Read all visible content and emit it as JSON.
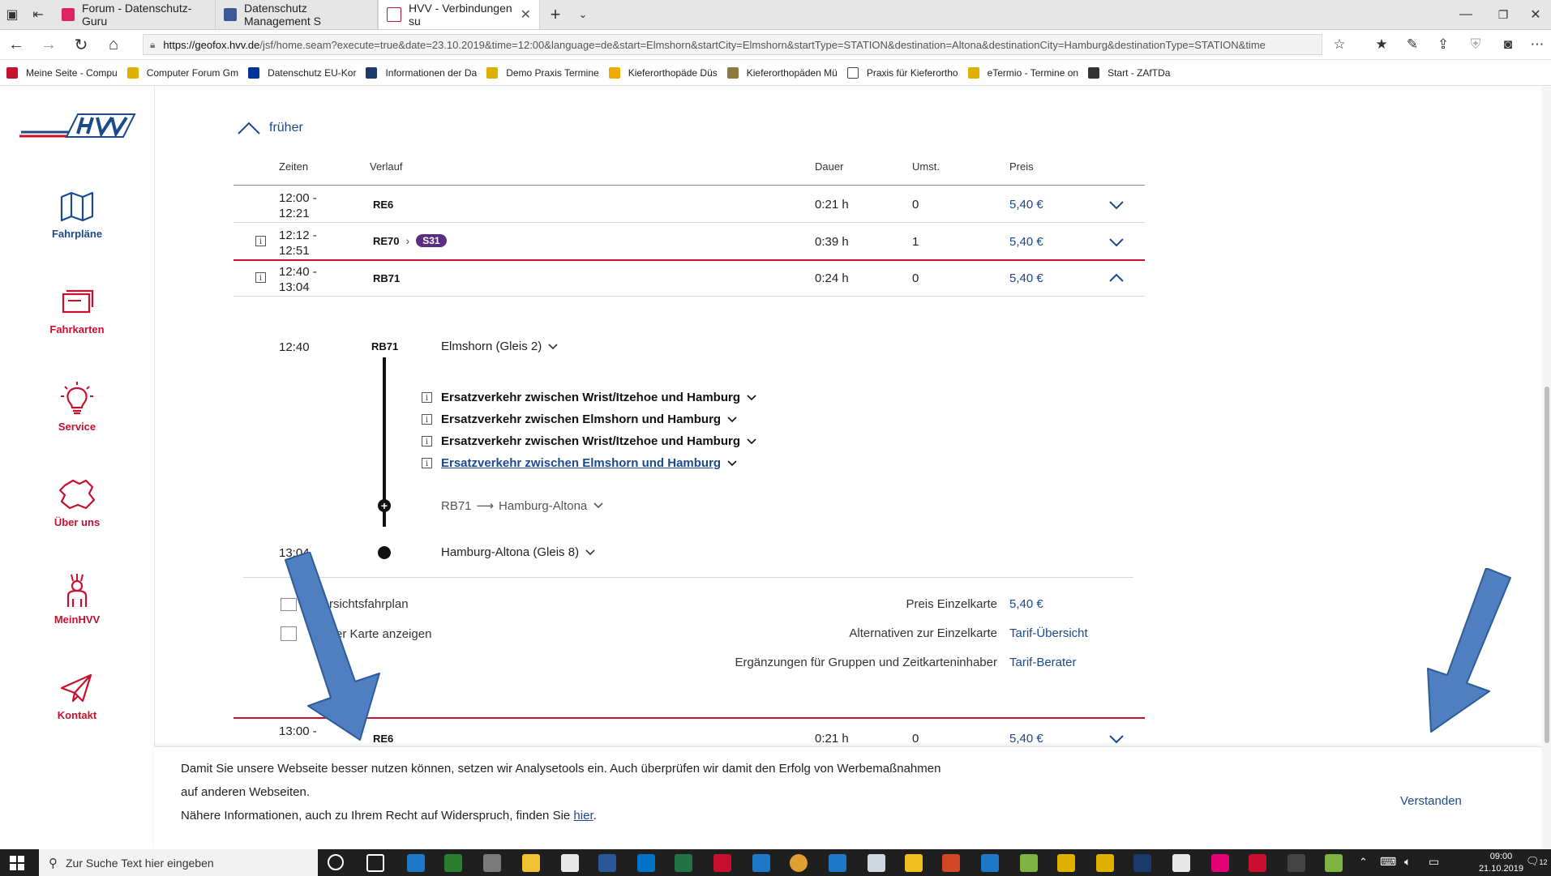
{
  "browser": {
    "tabs": [
      {
        "title": "Forum - Datenschutz-Guru",
        "color": "#e0245e"
      },
      {
        "title": "Datenschutz Management S",
        "color": "#3b5998"
      },
      {
        "title": "HVV - Verbindungen su",
        "color": "#c8102e"
      }
    ],
    "url_host": "https://geofox.hvv.de",
    "url_path": "/jsf/home.seam?execute=true&date=23.10.2019&time=12:00&language=de&start=Elmshorn&startCity=Elmshorn&startType=STATION&destination=Altona&destinationCity=Hamburg&destinationType=STATION&time",
    "favorites": [
      {
        "label": "Meine Seite - Compu",
        "color": "#c8102e"
      },
      {
        "label": "Computer Forum Gm",
        "color": "#e0b000"
      },
      {
        "label": "Datenschutz  EU-Kor",
        "color": "#003399"
      },
      {
        "label": "Informationen der Da",
        "color": "#1b3a6b"
      },
      {
        "label": "Demo Praxis Termine",
        "color": "#e0b000"
      },
      {
        "label": "Kieferorthopäde Düs",
        "color": "#f2a900"
      },
      {
        "label": "Kieferorthopäden Mü",
        "color": "#8a7a40"
      },
      {
        "label": "Praxis für Kieferortho",
        "color": "#444444"
      },
      {
        "label": "eTermio - Termine on",
        "color": "#e0b000"
      },
      {
        "label": "Start - ZAfTDa",
        "color": "#333333"
      }
    ]
  },
  "sidebar": {
    "items": [
      {
        "label": "Fahrpläne",
        "icon": "map-icon"
      },
      {
        "label": "Fahrkarten",
        "icon": "ticket-icon"
      },
      {
        "label": "Service",
        "icon": "lightbulb-icon"
      },
      {
        "label": "Über uns",
        "icon": "region-map-icon"
      },
      {
        "label": "MeinHVV",
        "icon": "person-icon"
      },
      {
        "label": "Kontakt",
        "icon": "paper-plane-icon"
      }
    ]
  },
  "results": {
    "earlier": "früher",
    "headers": {
      "zeiten": "Zeiten",
      "verlauf": "Verlauf",
      "dauer": "Dauer",
      "umst": "Umst.",
      "preis": "Preis"
    },
    "rows": [
      {
        "start": "12:00 -",
        "end": "12:21",
        "line": "RE6",
        "duration": "0:21 h",
        "changes": "0",
        "price": "5,40 €"
      },
      {
        "start": "12:12 -",
        "end": "12:51",
        "line": "RE70",
        "line2": "S31",
        "duration": "0:39 h",
        "changes": "1",
        "price": "5,40 €"
      },
      {
        "start": "12:40 -",
        "end": "13:04",
        "line": "RB71",
        "duration": "0:24 h",
        "changes": "0",
        "price": "5,40 €"
      },
      {
        "start": "13:00 -",
        "line": "RE6",
        "duration": "0:21 h",
        "changes": "0",
        "price": "5,40 €"
      }
    ],
    "detail": {
      "dep_time": "12:40",
      "line": "RB71",
      "dep_stop": "Elmshorn (Gleis 2)",
      "notices": [
        "Ersatzverkehr zwischen Wrist/Itzehoe und Hamburg",
        "Ersatzverkehr zwischen Elmshorn und Hamburg",
        "Ersatzverkehr zwischen Wrist/Itzehoe und Hamburg",
        "Ersatzverkehr zwischen Elmshorn und Hamburg"
      ],
      "direction_line": "RB71",
      "direction": "Hamburg-Altona",
      "arr_time": "13:04",
      "arr_stop": "Hamburg-Altona (Gleis 8)",
      "timetable_link": "rsichtsfahrplan",
      "map_link": "er Karte anzeigen",
      "price_rows": [
        {
          "label": "Preis Einzelkarte",
          "value": "5,40 €"
        },
        {
          "label": "Alternativen zur Einzelkarte",
          "value": "Tarif-Übersicht"
        },
        {
          "label": "Ergänzungen für Gruppen und Zeitkarteninhaber",
          "value": "Tarif-Berater"
        }
      ]
    }
  },
  "cookie": {
    "line1": "Damit Sie unsere Webseite besser nutzen können, setzen wir Analysetools ein. Auch überprüfen wir damit den Erfolg von Werbemaßnahmen",
    "line2": "auf anderen Webseiten.",
    "line3_prefix": "Nähere Informationen, auch zu Ihrem Recht auf Widerspruch, finden Sie",
    "line3_link": "hier",
    "line3_suffix": ".",
    "accept": "Verstanden"
  },
  "taskbar": {
    "search_placeholder": "Zur Suche Text hier eingeben",
    "time": "09:00",
    "date": "21.10.2019",
    "notif_count": "12"
  },
  "colors": {
    "hvv_red": "#c8102e",
    "hvv_blue": "#1b4a8c",
    "arrow_blue": "#4f7fc0",
    "s31_purple": "#5b2d82"
  }
}
